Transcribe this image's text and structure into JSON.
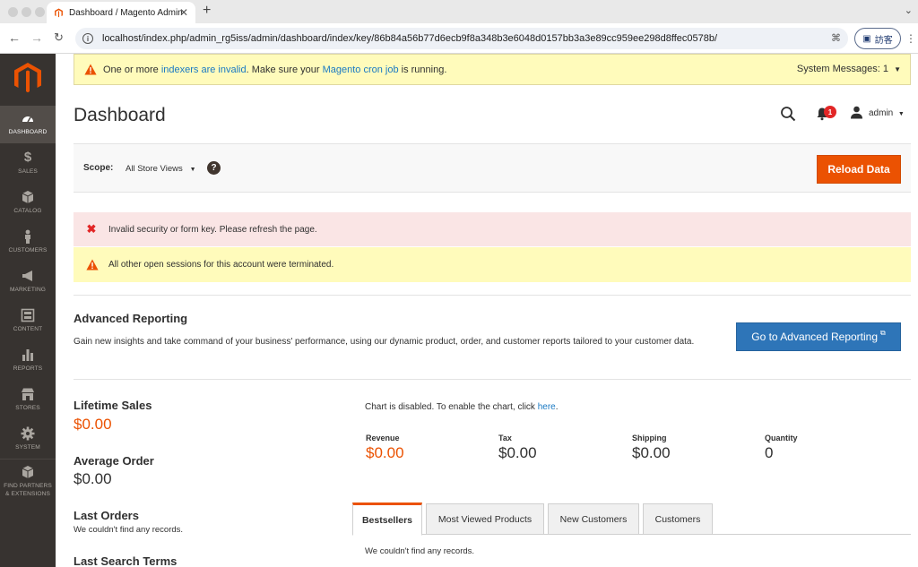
{
  "browser": {
    "tab_title": "Dashboard / Magento Admin",
    "url": "localhost/index.php/admin_rg5iss/admin/dashboard/index/key/86b84a56b77d6ecb9f8a348b3e6048d0157bb3a3e89cc959ee298d8ffec0578b/",
    "guest_label": "訪客"
  },
  "sidebar": {
    "items": [
      {
        "label": "Dashboard",
        "icon": "dashboard-icon"
      },
      {
        "label": "Sales",
        "icon": "dollar-icon"
      },
      {
        "label": "Catalog",
        "icon": "box-icon"
      },
      {
        "label": "Customers",
        "icon": "person-icon"
      },
      {
        "label": "Marketing",
        "icon": "megaphone-icon"
      },
      {
        "label": "Content",
        "icon": "layout-icon"
      },
      {
        "label": "Reports",
        "icon": "bar-chart-icon"
      },
      {
        "label": "Stores",
        "icon": "store-icon"
      },
      {
        "label": "System",
        "icon": "gear-icon"
      },
      {
        "label": "Find Partners",
        "label2": "& Extensions",
        "icon": "partners-box-icon"
      }
    ]
  },
  "system_bar": {
    "prefix": "One or more ",
    "link1": "indexers are invalid",
    "middle": ". Make sure your ",
    "link2": "Magento cron job",
    "suffix": " is running.",
    "messages": "System Messages: 1"
  },
  "header": {
    "title": "Dashboard",
    "notifications_count": "1",
    "user": "admin"
  },
  "scope": {
    "label": "Scope:",
    "value": "All Store Views",
    "reload_button": "Reload Data"
  },
  "messages": {
    "error": "Invalid security or form key. Please refresh the page.",
    "warning": "All other open sessions for this account were terminated."
  },
  "advanced_reporting": {
    "title": "Advanced Reporting",
    "description": "Gain new insights and take command of your business' performance, using our dynamic product, order, and customer reports tailored to your customer data.",
    "button": "Go to Advanced Reporting"
  },
  "stats": {
    "lifetime_sales_label": "Lifetime Sales",
    "lifetime_sales_value": "$0.00",
    "average_order_label": "Average Order",
    "average_order_value": "$0.00",
    "last_orders_label": "Last Orders",
    "last_orders_empty": "We couldn't find any records.",
    "last_search_label": "Last Search Terms"
  },
  "chart": {
    "disabled_text": "Chart is disabled. To enable the chart, click ",
    "disabled_link": "here",
    "disabled_end": "."
  },
  "totals": [
    {
      "label": "Revenue",
      "value": "$0.00"
    },
    {
      "label": "Tax",
      "value": "$0.00"
    },
    {
      "label": "Shipping",
      "value": "$0.00"
    },
    {
      "label": "Quantity",
      "value": "0"
    }
  ],
  "tabs": {
    "items": [
      "Bestsellers",
      "Most Viewed Products",
      "New Customers",
      "Customers"
    ],
    "empty": "We couldn't find any records."
  },
  "colors": {
    "accent": "#eb5202",
    "link": "#1979c3",
    "sidebar": "#373330"
  }
}
